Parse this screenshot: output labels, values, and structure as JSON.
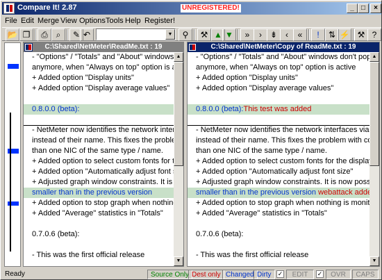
{
  "window": {
    "title": "Compare It! 2.87",
    "unregistered": "UNREGISTERED!"
  },
  "menu": [
    "File",
    "Edit",
    "Merge",
    "View",
    "Options",
    "Tools",
    "Help",
    "Register!"
  ],
  "toolbar": {
    "combo_value": ""
  },
  "left_pane": {
    "title": "C:\\Shared\\NetMeter\\ReadMe.txt : 19",
    "lines": [
      {
        "t": "- \"Options\" / \"Totals\" and \"About\" windows don't pop up",
        "c": ""
      },
      {
        "t": "anymore, when \"Always on top\" option is active",
        "c": ""
      },
      {
        "t": "+ Added option \"Display units\"",
        "c": ""
      },
      {
        "t": "+ Added option \"Display average values\"",
        "c": ""
      },
      {
        "t": "",
        "c": ""
      },
      {
        "t": "0.8.0.0 (beta):",
        "c": "grn-blue"
      },
      {
        "t": "",
        "c": ""
      },
      {
        "t": "- NetMeter now identifies the network interfaces via the",
        "c": "boxtop"
      },
      {
        "t": "instead of their name. This fixes the problem with",
        "c": ""
      },
      {
        "t": "than one NIC of the same type / name.",
        "c": ""
      },
      {
        "t": "+ Added option to select custom fonts for the display",
        "c": ""
      },
      {
        "t": "+ Added option \"Automatically adjust font size\"",
        "c": ""
      },
      {
        "t": "+ Adjusted graph window constraints. It is now possible",
        "c": ""
      },
      {
        "t": "smaller than in the previous version",
        "c": "grn-blue"
      },
      {
        "t": "+ Added option to stop graph when nothing is monitored",
        "c": ""
      },
      {
        "t": "+ Added \"Average\" statistics in \"Totals\"",
        "c": ""
      },
      {
        "t": "",
        "c": ""
      },
      {
        "t": "0.7.0.6 (beta):",
        "c": ""
      },
      {
        "t": "",
        "c": ""
      },
      {
        "t": "- This was the first official release",
        "c": ""
      }
    ]
  },
  "right_pane": {
    "title": "C:\\Shared\\NetMeter\\Copy of ReadMe.txt : 19",
    "lines": [
      {
        "t": "- \"Options\" / \"Totals\" and \"About\" windows don't pop up",
        "c": ""
      },
      {
        "t": "anymore, when \"Always on top\" option is active",
        "c": ""
      },
      {
        "t": "+ Added option \"Display units\"",
        "c": ""
      },
      {
        "t": "+ Added option \"Display average values\"",
        "c": ""
      },
      {
        "t": "",
        "c": ""
      },
      {
        "t": "0.8.0.0 (beta):",
        "c": "grn-blue",
        "add": "This test was added"
      },
      {
        "t": "",
        "c": ""
      },
      {
        "t": "- NetMeter now identifies the network interfaces via the",
        "c": "boxtop"
      },
      {
        "t": "instead of their name. This fixes the problem with comp",
        "c": ""
      },
      {
        "t": "than one NIC of the same type / name.",
        "c": ""
      },
      {
        "t": "+ Added option to select custom fonts for the display p",
        "c": ""
      },
      {
        "t": "+ Added option \"Automatically adjust font size\"",
        "c": ""
      },
      {
        "t": "+ Adjusted graph window constraints. It is now possible",
        "c": ""
      },
      {
        "t": "smaller than in the previous version",
        "c": "grn-blue",
        "add": " webattack added"
      },
      {
        "t": "+ Added option to stop graph when nothing is monitore",
        "c": ""
      },
      {
        "t": "+ Added \"Average\" statistics in \"Totals\"",
        "c": ""
      },
      {
        "t": "",
        "c": ""
      },
      {
        "t": "0.7.0.6 (beta):",
        "c": ""
      },
      {
        "t": "",
        "c": ""
      },
      {
        "t": "- This was the first official release",
        "c": ""
      }
    ]
  },
  "status": {
    "ready": "Ready",
    "source_only": "Source Only",
    "dest_only": "Dest only",
    "changed": "Changed",
    "dirty": "Dirty",
    "edit": "EDIT",
    "ovr": "OVR",
    "caps": "CAPS"
  },
  "colors": {
    "source_only": "#008000",
    "dest_only": "#cc0000",
    "changed": "#0033cc",
    "dirty": "#0033cc",
    "titlebar": "#0a246a",
    "diff_bg": "#c8e0c8"
  }
}
